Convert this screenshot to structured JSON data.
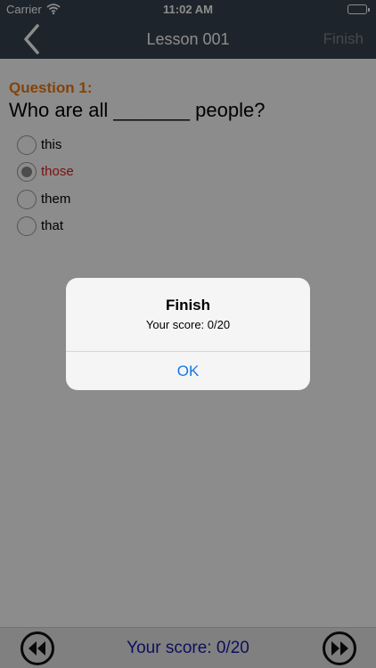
{
  "status_bar": {
    "carrier": "Carrier",
    "time": "11:02 AM",
    "wifi_icon": "wifi-icon",
    "battery_icon": "battery-icon"
  },
  "nav_bar": {
    "back_icon": "chevron-left-icon",
    "title": "Lesson 001",
    "finish_label": "Finish"
  },
  "question": {
    "label": "Question 1:",
    "text": "Who are all _______ people?",
    "options": [
      {
        "label": "this",
        "selected": false
      },
      {
        "label": "those",
        "selected": true
      },
      {
        "label": "them",
        "selected": false
      },
      {
        "label": "that",
        "selected": false
      }
    ]
  },
  "footer": {
    "prev_icon": "rewind-icon",
    "next_icon": "fast-forward-icon",
    "score_text": "Your score: 0/20"
  },
  "alert": {
    "title": "Finish",
    "message": "Your score: 0/20",
    "ok_label": "OK"
  },
  "colors": {
    "bar_bg": "#37434f",
    "question_label": "#ee7a12",
    "selected_option": "#e02020",
    "score_text": "#1a1aa8",
    "alert_button": "#1578e6"
  }
}
